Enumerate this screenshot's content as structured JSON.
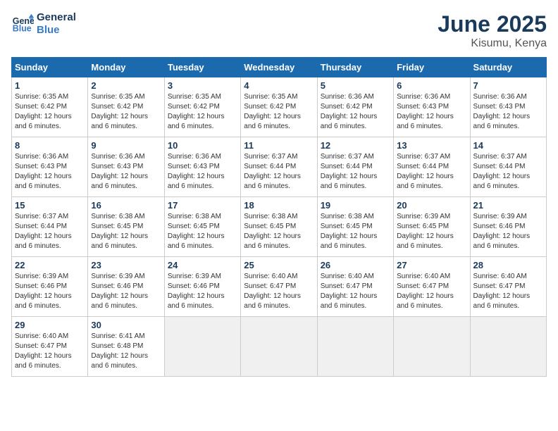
{
  "logo": {
    "line1": "General",
    "line2": "Blue"
  },
  "title": "June 2025",
  "location": "Kisumu, Kenya",
  "weekdays": [
    "Sunday",
    "Monday",
    "Tuesday",
    "Wednesday",
    "Thursday",
    "Friday",
    "Saturday"
  ],
  "weeks": [
    [
      {
        "day": 1,
        "sunrise": "6:35 AM",
        "sunset": "6:42 PM",
        "daylight": "12 hours and 6 minutes."
      },
      {
        "day": 2,
        "sunrise": "6:35 AM",
        "sunset": "6:42 PM",
        "daylight": "12 hours and 6 minutes."
      },
      {
        "day": 3,
        "sunrise": "6:35 AM",
        "sunset": "6:42 PM",
        "daylight": "12 hours and 6 minutes."
      },
      {
        "day": 4,
        "sunrise": "6:35 AM",
        "sunset": "6:42 PM",
        "daylight": "12 hours and 6 minutes."
      },
      {
        "day": 5,
        "sunrise": "6:36 AM",
        "sunset": "6:42 PM",
        "daylight": "12 hours and 6 minutes."
      },
      {
        "day": 6,
        "sunrise": "6:36 AM",
        "sunset": "6:43 PM",
        "daylight": "12 hours and 6 minutes."
      },
      {
        "day": 7,
        "sunrise": "6:36 AM",
        "sunset": "6:43 PM",
        "daylight": "12 hours and 6 minutes."
      }
    ],
    [
      {
        "day": 8,
        "sunrise": "6:36 AM",
        "sunset": "6:43 PM",
        "daylight": "12 hours and 6 minutes."
      },
      {
        "day": 9,
        "sunrise": "6:36 AM",
        "sunset": "6:43 PM",
        "daylight": "12 hours and 6 minutes."
      },
      {
        "day": 10,
        "sunrise": "6:36 AM",
        "sunset": "6:43 PM",
        "daylight": "12 hours and 6 minutes."
      },
      {
        "day": 11,
        "sunrise": "6:37 AM",
        "sunset": "6:44 PM",
        "daylight": "12 hours and 6 minutes."
      },
      {
        "day": 12,
        "sunrise": "6:37 AM",
        "sunset": "6:44 PM",
        "daylight": "12 hours and 6 minutes."
      },
      {
        "day": 13,
        "sunrise": "6:37 AM",
        "sunset": "6:44 PM",
        "daylight": "12 hours and 6 minutes."
      },
      {
        "day": 14,
        "sunrise": "6:37 AM",
        "sunset": "6:44 PM",
        "daylight": "12 hours and 6 minutes."
      }
    ],
    [
      {
        "day": 15,
        "sunrise": "6:37 AM",
        "sunset": "6:44 PM",
        "daylight": "12 hours and 6 minutes."
      },
      {
        "day": 16,
        "sunrise": "6:38 AM",
        "sunset": "6:45 PM",
        "daylight": "12 hours and 6 minutes."
      },
      {
        "day": 17,
        "sunrise": "6:38 AM",
        "sunset": "6:45 PM",
        "daylight": "12 hours and 6 minutes."
      },
      {
        "day": 18,
        "sunrise": "6:38 AM",
        "sunset": "6:45 PM",
        "daylight": "12 hours and 6 minutes."
      },
      {
        "day": 19,
        "sunrise": "6:38 AM",
        "sunset": "6:45 PM",
        "daylight": "12 hours and 6 minutes."
      },
      {
        "day": 20,
        "sunrise": "6:39 AM",
        "sunset": "6:45 PM",
        "daylight": "12 hours and 6 minutes."
      },
      {
        "day": 21,
        "sunrise": "6:39 AM",
        "sunset": "6:46 PM",
        "daylight": "12 hours and 6 minutes."
      }
    ],
    [
      {
        "day": 22,
        "sunrise": "6:39 AM",
        "sunset": "6:46 PM",
        "daylight": "12 hours and 6 minutes."
      },
      {
        "day": 23,
        "sunrise": "6:39 AM",
        "sunset": "6:46 PM",
        "daylight": "12 hours and 6 minutes."
      },
      {
        "day": 24,
        "sunrise": "6:39 AM",
        "sunset": "6:46 PM",
        "daylight": "12 hours and 6 minutes."
      },
      {
        "day": 25,
        "sunrise": "6:40 AM",
        "sunset": "6:47 PM",
        "daylight": "12 hours and 6 minutes."
      },
      {
        "day": 26,
        "sunrise": "6:40 AM",
        "sunset": "6:47 PM",
        "daylight": "12 hours and 6 minutes."
      },
      {
        "day": 27,
        "sunrise": "6:40 AM",
        "sunset": "6:47 PM",
        "daylight": "12 hours and 6 minutes."
      },
      {
        "day": 28,
        "sunrise": "6:40 AM",
        "sunset": "6:47 PM",
        "daylight": "12 hours and 6 minutes."
      }
    ],
    [
      {
        "day": 29,
        "sunrise": "6:40 AM",
        "sunset": "6:47 PM",
        "daylight": "12 hours and 6 minutes."
      },
      {
        "day": 30,
        "sunrise": "6:41 AM",
        "sunset": "6:48 PM",
        "daylight": "12 hours and 6 minutes."
      },
      null,
      null,
      null,
      null,
      null
    ]
  ]
}
